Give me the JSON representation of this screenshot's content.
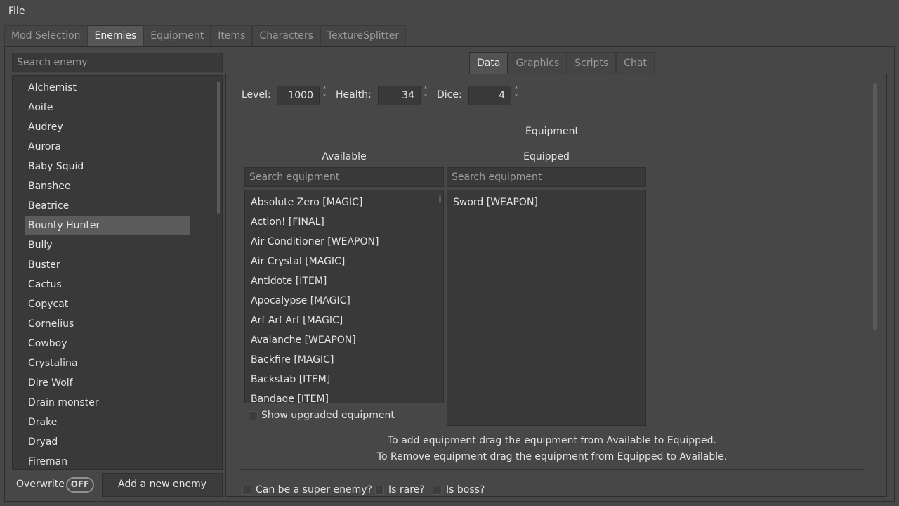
{
  "menubar": {
    "file": "File"
  },
  "tabs": [
    "Mod Selection",
    "Enemies",
    "Equipment",
    "Items",
    "Characters",
    "TextureSplitter"
  ],
  "sidebar": {
    "search_placeholder": "Search enemy",
    "enemies": [
      "Alchemist",
      "Aoife",
      "Audrey",
      "Aurora",
      "Baby Squid",
      "Banshee",
      "Beatrice",
      "Bounty Hunter",
      "Bully",
      "Buster",
      "Cactus",
      "Copycat",
      "Cornelius",
      "Cowboy",
      "Crystalina",
      "Dire Wolf",
      "Drain monster",
      "Drake",
      "Dryad",
      "Fireman"
    ],
    "selected": "Bounty Hunter",
    "overwrite_label": "Overwrite",
    "overwrite_state": "OFF",
    "add_button": "Add a new enemy"
  },
  "subtabs": [
    "Data",
    "Graphics",
    "Scripts",
    "Chat"
  ],
  "stats": {
    "level_label": "Level:",
    "level_value": "1000",
    "health_label": "Health:",
    "health_value": "34",
    "dice_label": "Dice:",
    "dice_value": "4"
  },
  "equipment": {
    "group_title": "Equipment",
    "available_title": "Available",
    "equipped_title": "Equipped",
    "available_search_placeholder": "Search equipment",
    "equipped_search_placeholder": "Search equipment",
    "available": [
      "Absolute Zero [MAGIC]",
      "Action! [FINAL]",
      "Air Conditioner [WEAPON]",
      "Air Crystal [MAGIC]",
      "Antidote [ITEM]",
      "Apocalypse [MAGIC]",
      "Arf Arf Arf [MAGIC]",
      "Avalanche [WEAPON]",
      "Backfire [MAGIC]",
      "Backstab [ITEM]",
      "Bandage [ITEM]"
    ],
    "equipped": [
      "Sword [WEAPON]"
    ],
    "show_upgraded_label": "Show upgraded equipment",
    "hint_line1": "To add equipment drag the equipment from Available to Equipped.",
    "hint_line2": "To Remove equipment drag the equipment from Equipped to Available."
  },
  "flags": {
    "super_enemy": "Can be a super enemy?",
    "is_rare": "Is rare?",
    "is_boss": "Is boss?"
  }
}
